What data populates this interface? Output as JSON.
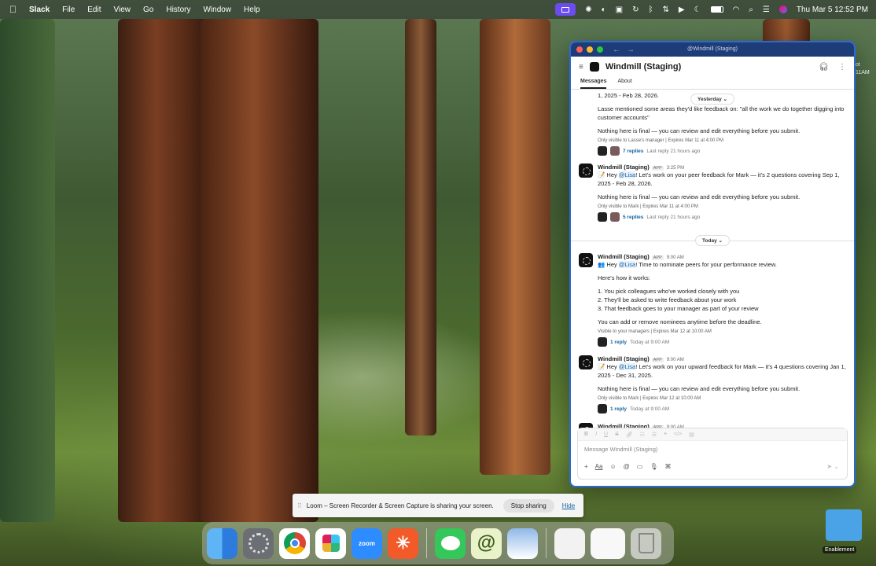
{
  "menubar": {
    "app": "Slack",
    "menus": [
      "File",
      "Edit",
      "View",
      "Go",
      "History",
      "Window",
      "Help"
    ],
    "clock": "Thu Mar 5  12:52 PM"
  },
  "desktop_edge_text": [
    "ot",
    "11AM"
  ],
  "window": {
    "title": "@Windmill (Staging)",
    "channel_name": "Windmill (Staging)",
    "tabs": [
      "Messages",
      "About"
    ]
  },
  "messages": {
    "divider_yesterday": "Yesterday",
    "divider_today": "Today",
    "m1": {
      "line1": "1, 2025 - Feb 28, 2026.",
      "line2": "Lasse mentioned some areas they'd like feedback on: \"all the work we do together digging into customer accounts\"",
      "line3": "Nothing here is final — you can review and edit everything before you submit.",
      "meta": "Only visible to Lasse's manager | Expires Mar 11 at 4:00 PM",
      "replies": "7 replies",
      "last_reply": "Last reply 21 hours ago"
    },
    "m2": {
      "sender": "Windmill (Staging)",
      "app": "APP",
      "time": "3:25 PM",
      "pre": "📝 Hey ",
      "mention": "@Lisa",
      "post": "! Let's work on your peer feedback for Mark — it's 2 questions covering Sep 1, 2025 - Feb 28, 2026.",
      "line2": "Nothing here is final — you can review and edit everything before you submit.",
      "meta": "Only visible to Mark | Expires Mar 11 at 4:00 PM",
      "replies": "5 replies",
      "last_reply": "Last reply 21 hours ago"
    },
    "m3": {
      "sender": "Windmill (Staging)",
      "app": "APP",
      "time": "9:00 AM",
      "pre": "👥 Hey ",
      "mention": "@Lisa",
      "post": "! Time to nominate peers for your performance review.",
      "how": "Here's how it works:",
      "step1": "1.  You pick colleagues who've worked closely with you",
      "step2": "2.  They'll be asked to write feedback about your work",
      "step3": "3.  That feedback goes to your manager as part of your review",
      "line_end": "You can add or remove nominees anytime before the deadline.",
      "meta": "Visible to your managers | Expires Mar 12 at 10:00 AM",
      "replies": "1 reply",
      "last_reply": "Today at 9:00 AM"
    },
    "m4": {
      "sender": "Windmill (Staging)",
      "app": "APP",
      "time": "9:00 AM",
      "pre": "📝 Hey ",
      "mention": "@Lisa",
      "post": "! Let's work on your upward feedback for Mark — it's 4 questions covering Jan 1, 2025 - Dec 31, 2025.",
      "line2": "Nothing here is final — you can review and edit everything before you submit.",
      "meta": "Only visible to Mark | Expires Mar 12 at 10:00 AM",
      "replies": "1 reply",
      "last_reply": "Today at 9:00 AM"
    },
    "m5": {
      "sender": "Windmill (Staging)",
      "app": "APP",
      "time": "9:00 AM"
    }
  },
  "composer": {
    "placeholder": "Message Windmill (Staging)",
    "format_tool": "Aa"
  },
  "loom": {
    "text": "Loom – Screen Recorder & Screen Capture is sharing your screen.",
    "stop": "Stop sharing",
    "hide": "Hide"
  },
  "dock": {
    "zoom_label": "zoom"
  },
  "folder": {
    "label": "Enablement"
  }
}
